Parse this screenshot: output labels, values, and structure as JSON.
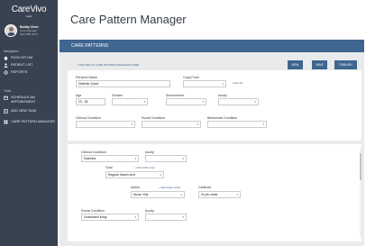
{
  "brand": {
    "logo": "CareVivo",
    "tagline": "Health"
  },
  "user": {
    "name": "Bobby Chen",
    "role": "Care Manager",
    "id": "ID# 2385 4570"
  },
  "nav": {
    "heading_main": "Navigation",
    "heading_tools": "Tools",
    "items": [
      {
        "label": "PUSH MY DM",
        "icon": "home-icon"
      },
      {
        "label": "PATIENT LIST",
        "icon": "user-list-icon"
      },
      {
        "label": "REPORTS",
        "icon": "gear-icon"
      }
    ],
    "tools": [
      {
        "label": "SCHEDULE AN APPOINTMENT",
        "icon": "calendar-icon"
      },
      {
        "label": "ADD NEW TASK",
        "icon": "task-icon"
      },
      {
        "label": "CARE PATTERN MANAGER",
        "icon": "grid-icon"
      }
    ]
  },
  "page": {
    "title": "Care Pattern Manager"
  },
  "panel": {
    "title": "CARE PATTERNS",
    "back_link": "< RETURN TO CARE PATTERN MANAGER HOME"
  },
  "buttons": {
    "new": "NEW",
    "save": "SAVE",
    "publish": "PUBLISH"
  },
  "form": {
    "persona_label": "Persona Name",
    "persona_value": "Diabetic Quest",
    "copy_from_label": "Copy From",
    "copy_from_value": "",
    "load_note": "Load note",
    "age_label": "Age",
    "age_value": "20 - 55",
    "gender_label": "Gender",
    "environment_label": "Environment",
    "acuity_label": "Acuity",
    "clinical_label": "Clinical Condition",
    "social_label": "Social Condition",
    "behavioral_label": "Behavioral Condition"
  },
  "pattern": {
    "clinical_label": "Clinical Condition",
    "clinical_value": "Diabetes",
    "acuity_label": "Acuity",
    "acuity_value": "",
    "goal_label": "Goal",
    "goal_link": "+ Add Another Goal",
    "goal_value": "Regular Insulin shot",
    "action_label": "Action",
    "action_link": "+ Add Another Action",
    "action_value": "Nurse Visit",
    "cadence_label": "Cadence",
    "cadence_value": "2x per week",
    "social_label": "Social Condition",
    "social_value": "Unassisted living",
    "acuity2_label": "Acuity",
    "acuity2_value": ""
  }
}
